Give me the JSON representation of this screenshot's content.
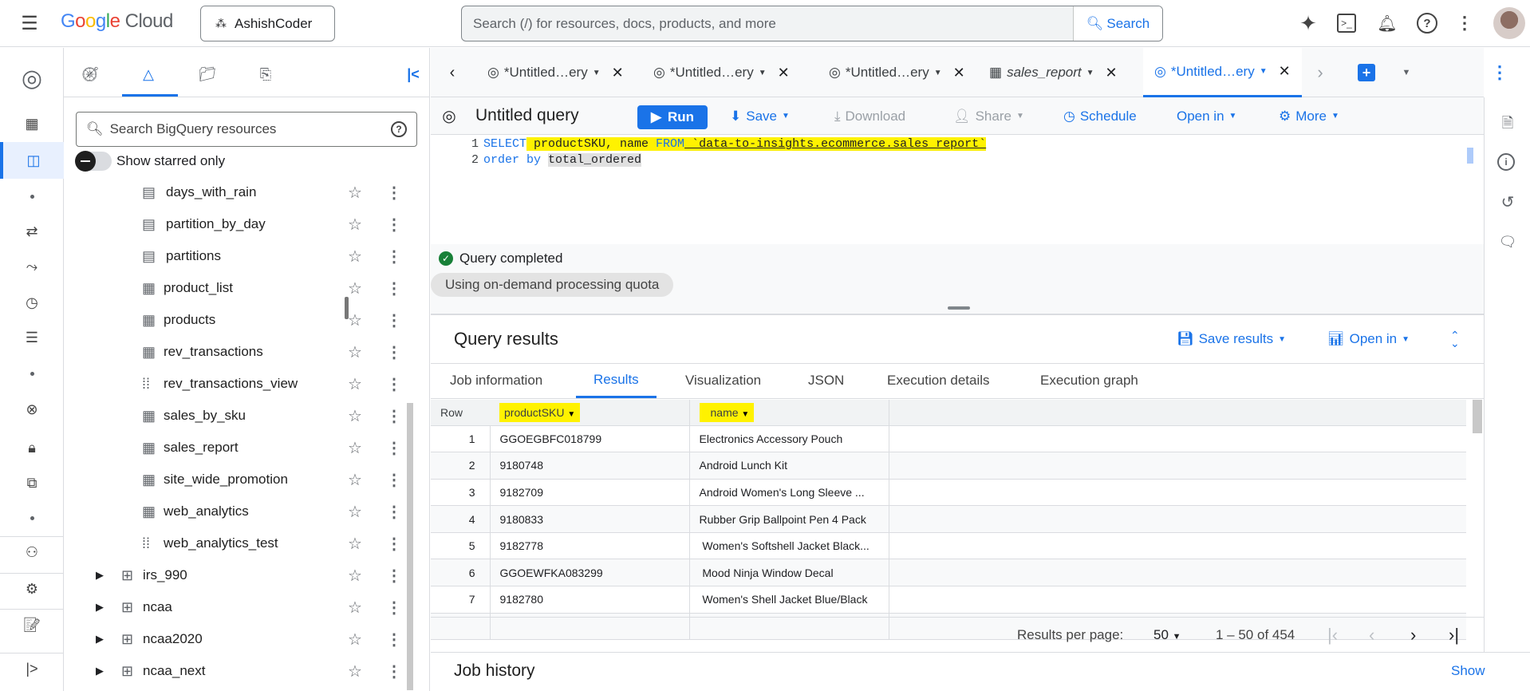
{
  "header": {
    "brand": "Google Cloud",
    "project": "AshishCoder",
    "search_placeholder": "Search (/) for resources, docs, products, and more",
    "search_button": "Search"
  },
  "side_panel": {
    "search_placeholder": "Search BigQuery resources",
    "starred_toggle": "Show starred only",
    "tables": [
      {
        "name": "days_with_rain",
        "type": "partitioned"
      },
      {
        "name": "partition_by_day",
        "type": "partitioned"
      },
      {
        "name": "partitions",
        "type": "partitioned"
      },
      {
        "name": "product_list",
        "type": "table"
      },
      {
        "name": "products",
        "type": "table"
      },
      {
        "name": "rev_transactions",
        "type": "table"
      },
      {
        "name": "rev_transactions_view",
        "type": "view"
      },
      {
        "name": "sales_by_sku",
        "type": "table"
      },
      {
        "name": "sales_report",
        "type": "table"
      },
      {
        "name": "site_wide_promotion",
        "type": "table"
      },
      {
        "name": "web_analytics",
        "type": "table"
      },
      {
        "name": "web_analytics_test",
        "type": "view"
      }
    ],
    "datasets": [
      "irs_990",
      "ncaa",
      "ncaa2020",
      "ncaa_next"
    ]
  },
  "tabs": [
    {
      "label": "*Untitled…ery",
      "icon": "query"
    },
    {
      "label": "*Untitled…ery",
      "icon": "query"
    },
    {
      "label": "*Untitled…ery",
      "icon": "query"
    },
    {
      "label": "sales_report",
      "icon": "table"
    },
    {
      "label": "*Untitled…ery",
      "icon": "query",
      "active": true
    }
  ],
  "toolbar": {
    "title": "Untitled query",
    "run": "Run",
    "save": "Save",
    "download": "Download",
    "share": "Share",
    "schedule": "Schedule",
    "open_in": "Open in",
    "more": "More"
  },
  "editor": {
    "lines": [
      {
        "num": "1",
        "kw1": "SELECT",
        "t1": " productSKU, name ",
        "kw2": "FROM",
        "t2": " `data-to-insights.ecommerce.sales_report`"
      },
      {
        "num": "2",
        "kw1": "order by",
        "t1": " ",
        "sel": "total_ordered"
      }
    ]
  },
  "status": {
    "text": "Query completed",
    "quota": "Using on-demand processing quota"
  },
  "results": {
    "title": "Query results",
    "save_results": "Save results",
    "open_in": "Open in",
    "tabs": [
      "Job information",
      "Results",
      "Visualization",
      "JSON",
      "Execution details",
      "Execution graph"
    ],
    "columns": [
      "Row",
      "productSKU",
      "name"
    ],
    "rows": [
      [
        "1",
        "GGOEGBFC018799",
        "Electronics Accessory Pouch"
      ],
      [
        "2",
        "9180748",
        "Android Lunch Kit"
      ],
      [
        "3",
        "9182709",
        "Android Women's Long Sleeve ..."
      ],
      [
        "4",
        "9180833",
        "Rubber Grip Ballpoint Pen 4 Pack"
      ],
      [
        "5",
        "9182778",
        " Women's Softshell Jacket Black..."
      ],
      [
        "6",
        "GGOEWFKA083299",
        " Mood Ninja Window Decal"
      ],
      [
        "7",
        "9182780",
        " Women's Shell Jacket Blue/Black"
      ]
    ],
    "per_page_label": "Results per page:",
    "per_page": "50",
    "range": "1 – 50 of 454"
  },
  "job_history": {
    "title": "Job history",
    "show": "Show"
  },
  "colors": {
    "accent": "#1a73e8",
    "highlight": "#fff200",
    "success": "#188038"
  }
}
